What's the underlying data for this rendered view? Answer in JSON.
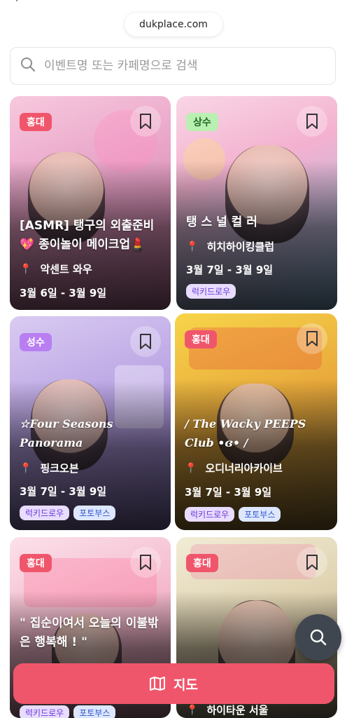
{
  "status_fragment": "ᐧ",
  "browser": {
    "url": "dukplace.com"
  },
  "search": {
    "placeholder": "이벤트명 또는 카페명으로 검색"
  },
  "cards": [
    {
      "area": "홍대",
      "title_lines": [
        "[ASMR] 탱구의 외출준비",
        "💖 종이놀이 메이크업💄"
      ],
      "location": "악센트 와우",
      "dates": "3월 6일 - 3월 9일",
      "tags": []
    },
    {
      "area": "상수",
      "title_lines": [
        "탱 스 널 컬 러"
      ],
      "location": "히치하이킹클럽",
      "dates": "3월 7일 - 3월 9일",
      "tags": [
        "럭키드로우"
      ]
    },
    {
      "area": "성수",
      "title_lines": [
        "☆Four Seasons",
        "Panorama"
      ],
      "location": "핑크오븐",
      "dates": "3월 7일 - 3월 9일",
      "tags": [
        "럭키드로우",
        "포토부스"
      ]
    },
    {
      "area": "홍대",
      "title_lines": [
        "/ The Wacky PEEPS",
        "Club •ɞ• /"
      ],
      "location": "오디너리아카이브",
      "dates": "3월 7일 - 3월 9일",
      "tags": [
        "럭키드로우",
        "포토부스"
      ]
    },
    {
      "area": "홍대",
      "title_lines": [
        "\" 집순이여서 오늘의 이불밖",
        "은 행복해 ! \""
      ],
      "location": "",
      "dates": "",
      "tags": [
        "럭키드로우",
        "포토부스"
      ]
    },
    {
      "area": "홍대",
      "title_lines": [],
      "location": "하이타운 서울",
      "dates": "",
      "tags": []
    }
  ],
  "map_button": {
    "label": "지도"
  },
  "colors": {
    "accent": "#f0566b",
    "badge_green": "#b9f0b1",
    "badge_purple": "#b87ef2",
    "tag_lavender": "#e8dcff",
    "tag_blue": "#dde7ff",
    "fab": "#3f4650"
  }
}
